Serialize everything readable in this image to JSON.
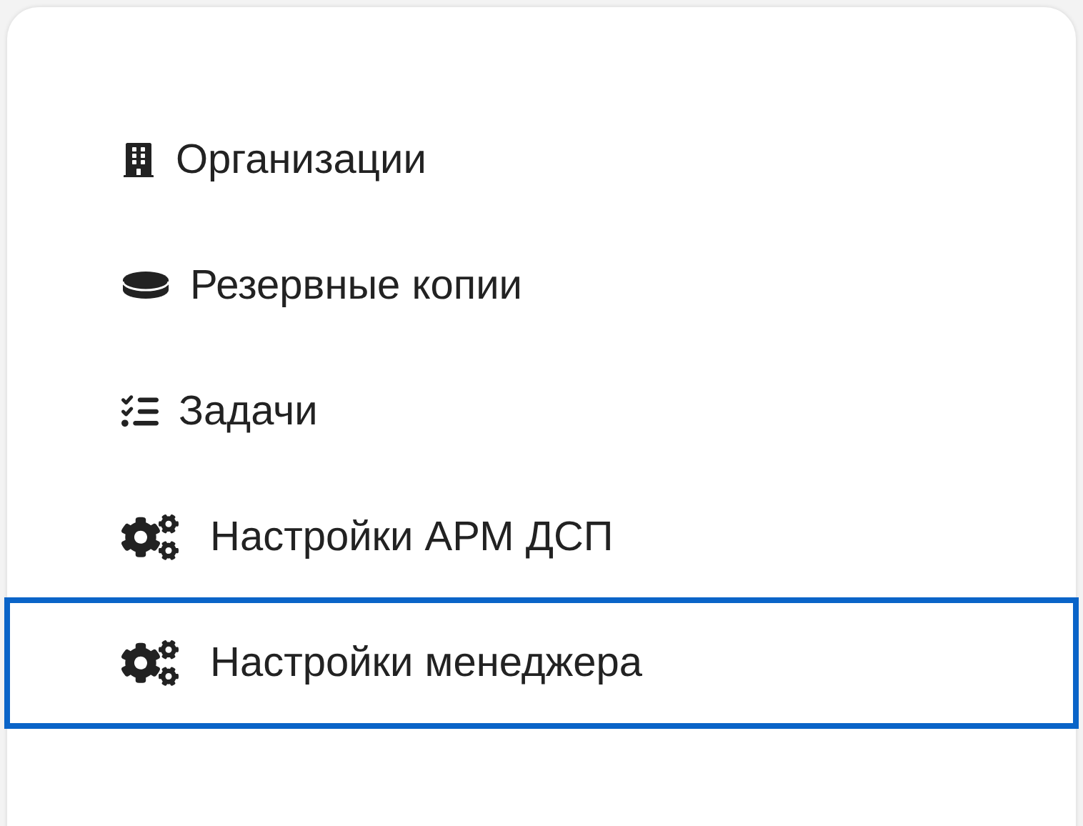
{
  "menu": {
    "items": [
      {
        "label": "Организации",
        "selected": false
      },
      {
        "label": "Резервные копии",
        "selected": false
      },
      {
        "label": "Задачи",
        "selected": false
      },
      {
        "label": "Настройки АРМ ДСП",
        "selected": false
      },
      {
        "label": "Настройки менеджера",
        "selected": true
      }
    ]
  }
}
